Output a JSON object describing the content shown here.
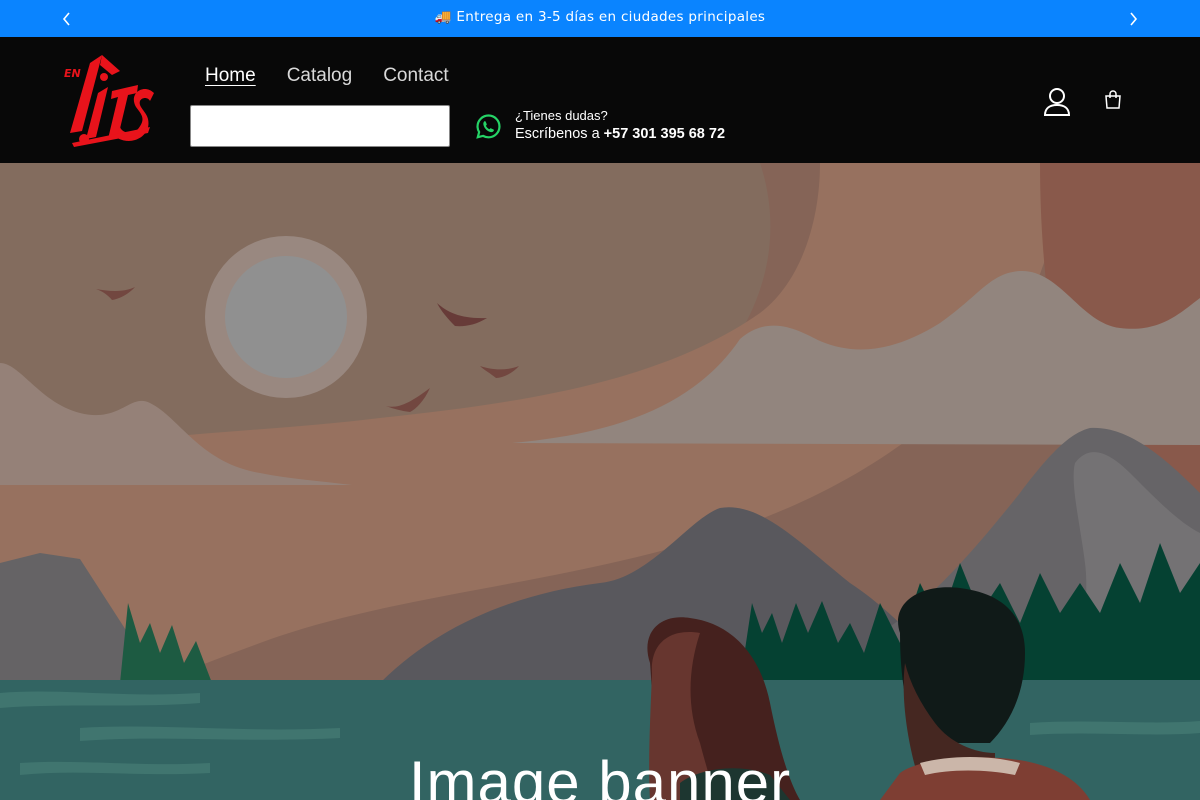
{
  "announcement": {
    "message": "🚚 Entrega en 3-5 días en ciudades principales"
  },
  "header": {
    "logo_text": "EN PITS",
    "nav": {
      "home": "Home",
      "catalog": "Catalog",
      "contact": "Contact"
    },
    "search": {
      "value": "",
      "placeholder": ""
    },
    "whatsapp": {
      "line1": "¿Tienes dudas?",
      "line2_prefix": "Escríbenos a ",
      "phone": "+57 301 395 68 72"
    }
  },
  "banner": {
    "title": "Image banner"
  },
  "colors": {
    "announcement_bg": "#0a84ff",
    "header_bg": "#080808",
    "logo_red": "#e8131b",
    "whatsapp_green": "#25d366"
  }
}
